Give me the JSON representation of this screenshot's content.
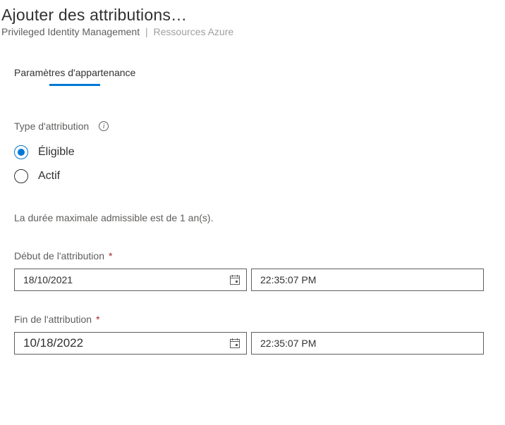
{
  "header": {
    "title": "Ajouter des attributions…",
    "breadcrumb_main": "Privileged Identity Management",
    "breadcrumb_sub": "Ressources Azure"
  },
  "section": {
    "title": "Paramètres d'appartenance"
  },
  "type_label": "Type d'attribution",
  "radio": {
    "eligible": "Éligible",
    "active": "Actif"
  },
  "hint": "La durée maximale admissible est de 1 an(s).",
  "start": {
    "label": "Début de l'attribution",
    "date": "18/10/2021",
    "time": "22:35:07 PM"
  },
  "end": {
    "label": "Fin de l'attribution",
    "date": "10/18/2022",
    "time": "22:35:07 PM"
  }
}
